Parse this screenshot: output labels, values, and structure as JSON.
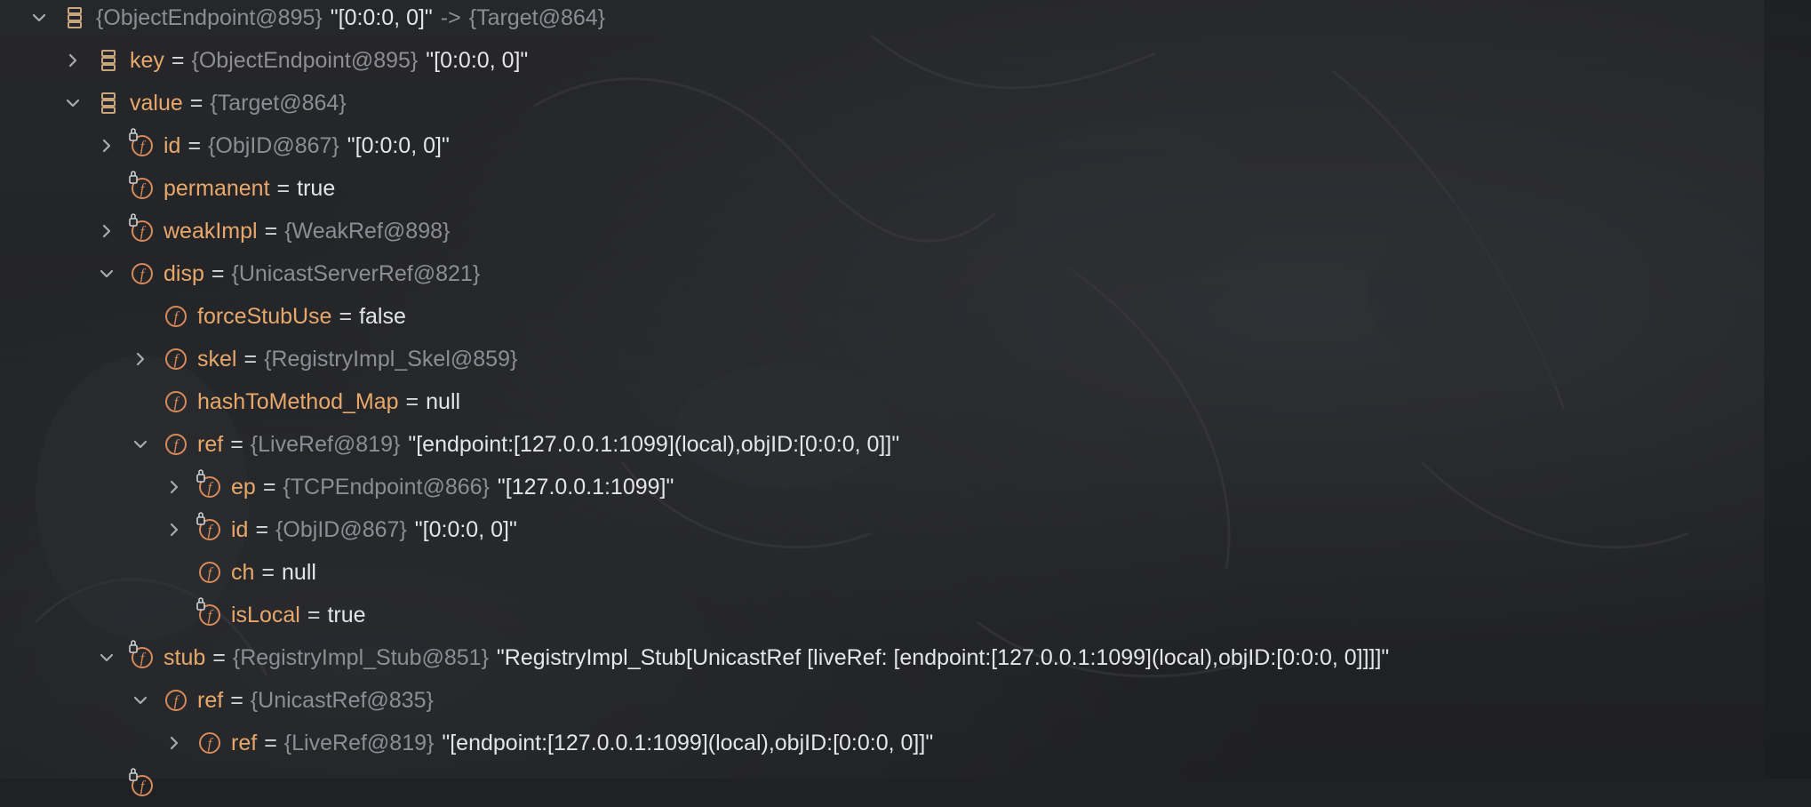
{
  "rows": [
    {
      "depth": 0,
      "expand": "open",
      "icon": "map-entry-icon",
      "name": "",
      "type": "{ObjectEndpoint@895}",
      "value": "\"[0:0:0, 0]\"",
      "arrow": "->",
      "target": "{Target@864}"
    },
    {
      "depth": 1,
      "expand": "closed",
      "icon": "map-entry-icon",
      "name": "key",
      "type": "{ObjectEndpoint@895}",
      "value": "\"[0:0:0, 0]\""
    },
    {
      "depth": 1,
      "expand": "open",
      "icon": "map-entry-icon",
      "name": "value",
      "type": "{Target@864}",
      "value": ""
    },
    {
      "depth": 2,
      "expand": "closed",
      "icon": "final-field-icon",
      "name": "id",
      "type": "{ObjID@867}",
      "value": "\"[0:0:0, 0]\""
    },
    {
      "depth": 2,
      "expand": "none",
      "icon": "final-field-icon",
      "name": "permanent",
      "type": "",
      "value": "true"
    },
    {
      "depth": 2,
      "expand": "closed",
      "icon": "final-field-icon",
      "name": "weakImpl",
      "type": "{WeakRef@898}",
      "value": ""
    },
    {
      "depth": 2,
      "expand": "open",
      "icon": "field-icon",
      "name": "disp",
      "type": "{UnicastServerRef@821}",
      "value": ""
    },
    {
      "depth": 3,
      "expand": "none",
      "icon": "field-icon",
      "name": "forceStubUse",
      "type": "",
      "value": "false"
    },
    {
      "depth": 3,
      "expand": "closed",
      "icon": "field-icon",
      "name": "skel",
      "type": "{RegistryImpl_Skel@859}",
      "value": ""
    },
    {
      "depth": 3,
      "expand": "none",
      "icon": "field-icon",
      "name": "hashToMethod_Map",
      "type": "",
      "value": "null"
    },
    {
      "depth": 3,
      "expand": "open",
      "icon": "field-icon",
      "name": "ref",
      "type": "{LiveRef@819}",
      "value": "\"[endpoint:[127.0.0.1:1099](local),objID:[0:0:0, 0]]\""
    },
    {
      "depth": 4,
      "expand": "closed",
      "icon": "final-field-icon",
      "name": "ep",
      "type": "{TCPEndpoint@866}",
      "value": "\"[127.0.0.1:1099]\""
    },
    {
      "depth": 4,
      "expand": "closed",
      "icon": "final-field-icon",
      "name": "id",
      "type": "{ObjID@867}",
      "value": "\"[0:0:0, 0]\""
    },
    {
      "depth": 4,
      "expand": "none",
      "icon": "field-icon",
      "name": "ch",
      "type": "",
      "value": "null"
    },
    {
      "depth": 4,
      "expand": "none",
      "icon": "final-field-icon",
      "name": "isLocal",
      "type": "",
      "value": "true"
    },
    {
      "depth": 2,
      "expand": "open",
      "icon": "final-field-icon",
      "name": "stub",
      "type": "{RegistryImpl_Stub@851}",
      "value": "\"RegistryImpl_Stub[UnicastRef [liveRef: [endpoint:[127.0.0.1:1099](local),objID:[0:0:0, 0]]]]\""
    },
    {
      "depth": 3,
      "expand": "open",
      "icon": "field-icon",
      "name": "ref",
      "type": "{UnicastRef@835}",
      "value": ""
    },
    {
      "depth": 4,
      "expand": "closed",
      "icon": "field-icon",
      "name": "ref",
      "type": "{LiveRef@819}",
      "value": "\"[endpoint:[127.0.0.1:1099](local),objID:[0:0:0, 0]]\""
    },
    {
      "depth": 2,
      "expand": "none",
      "icon": "final-field-icon",
      "name": "",
      "type": "",
      "value": ""
    }
  ],
  "colors": {
    "background": "#202124",
    "field_name": "#e8a86a",
    "type_ref": "#8c8e94",
    "value": "#e4e5e8",
    "icon_orange": "#d98a5a",
    "icon_entry": "#c9a57e"
  }
}
